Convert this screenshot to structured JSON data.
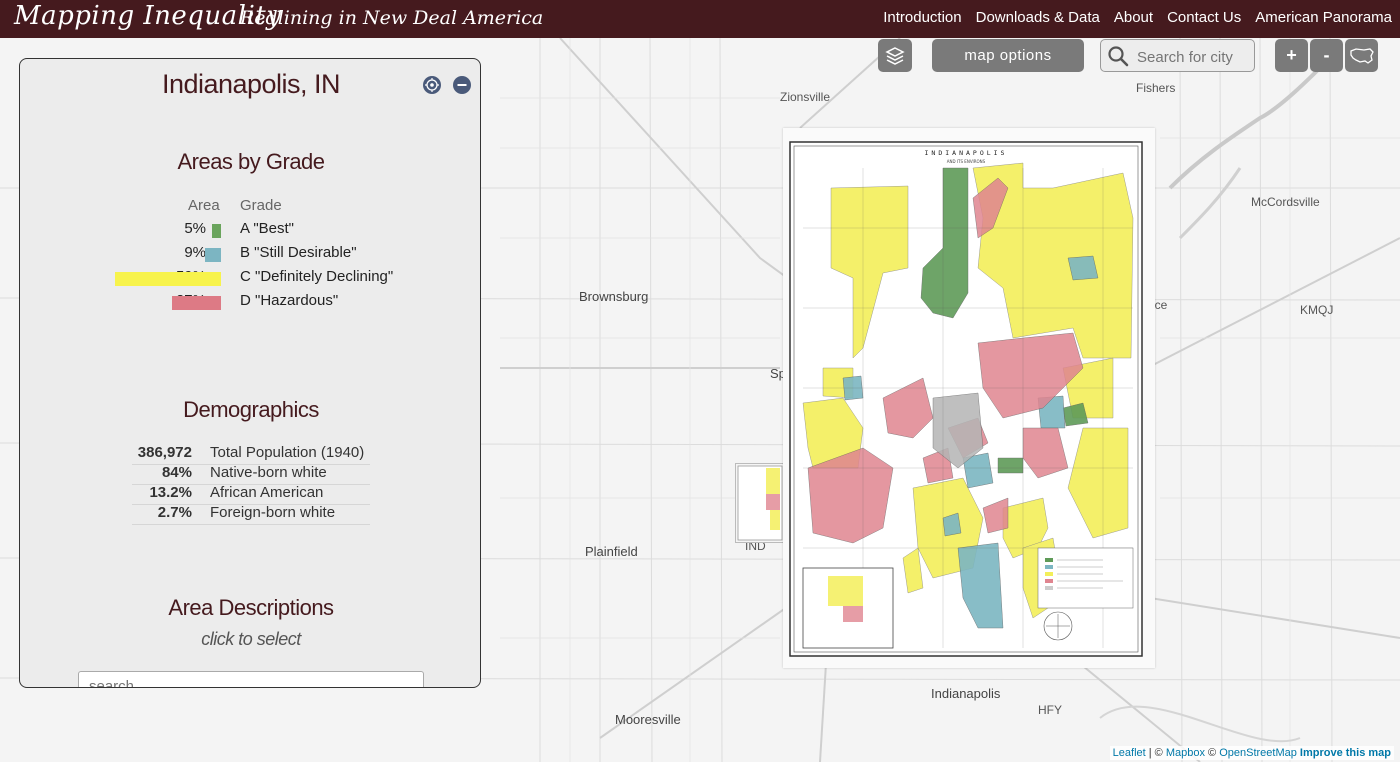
{
  "header": {
    "title": "Mapping Inequality",
    "subtitle": "Redlining in New Deal America",
    "nav": [
      "Introduction",
      "Downloads & Data",
      "About",
      "Contact Us",
      "American Panorama"
    ]
  },
  "controls": {
    "map_options": "map options",
    "search_placeholder": "Search for city",
    "zoom_in": "+",
    "zoom_out": "-"
  },
  "panel": {
    "city": "Indianapolis, IN",
    "grades_title": "Areas by Grade",
    "col_area": "Area",
    "col_grade": "Grade",
    "grades": [
      {
        "pct": "5%",
        "fraction": 0.05,
        "label": "A \"Best\"",
        "color": "#6aa45c"
      },
      {
        "pct": "9%",
        "fraction": 0.09,
        "label": "B \"Still Desirable\"",
        "color": "#7cb5c2"
      },
      {
        "pct": "59%",
        "fraction": 0.59,
        "label": "C \"Definitely Declining\"",
        "color": "#f7f34c"
      },
      {
        "pct": "27%",
        "fraction": 0.27,
        "label": "D \"Hazardous\"",
        "color": "#dd7a85"
      }
    ],
    "demographics_title": "Demographics",
    "demographics": [
      {
        "value": "386,972",
        "label": "Total Population (1940)"
      },
      {
        "value": "84%",
        "label": "Native-born white"
      },
      {
        "value": "13.2%",
        "label": "African American"
      },
      {
        "value": "2.7%",
        "label": "Foreign-born white"
      }
    ],
    "area_desc_title": "Area Descriptions",
    "click_hint": "click to select",
    "search_placeholder": "search"
  },
  "map_labels": {
    "zionsville": "Zionsville",
    "fishers": "Fishers",
    "mccordsville": "McCordsville",
    "brownsburg": "Brownsburg",
    "kmqj": "KMQJ",
    "plainfield": "Plainfield",
    "indianapolis": "Indianapolis",
    "mooresville": "Mooresville",
    "hfy": "HFY",
    "ind": "IND",
    "sp": "Sp",
    "nce": "nce"
  },
  "scan": {
    "title": "INDIANAPOLIS",
    "subtitle": "AND ITS ENVIRONS"
  },
  "attribution": {
    "leaflet": "Leaflet",
    "mapbox": "Mapbox",
    "osm": "OpenStreetMap",
    "improve": "Improve this map"
  }
}
